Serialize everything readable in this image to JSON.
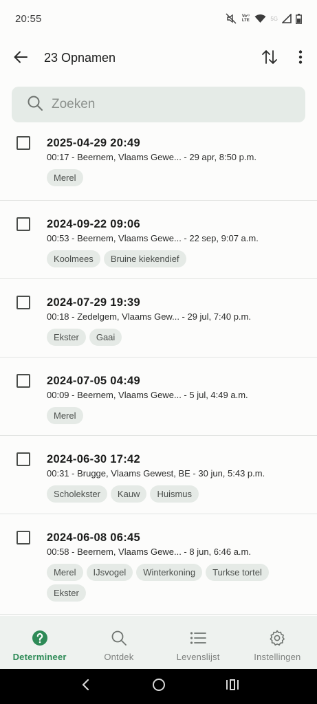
{
  "status_bar": {
    "time": "20:55",
    "volte": "Vo¹⁾ LTE",
    "network": "5G",
    "icons": [
      "mute-icon",
      "volte-icon",
      "wifi-icon",
      "signal-icon",
      "battery-icon"
    ]
  },
  "app_bar": {
    "title": "23 Opnamen",
    "back_icon": "arrow-left-icon",
    "sort_icon": "sort-arrows-icon",
    "more_icon": "more-vertical-icon"
  },
  "search": {
    "placeholder": "Zoeken",
    "value": ""
  },
  "recordings": [
    {
      "title": "2025-04-29 20:49",
      "subtitle": "00:17 - Beernem, Vlaams Gewe... - 29 apr, 8:50 p.m.",
      "tags": [
        "Merel"
      ]
    },
    {
      "title": "2024-09-22 09:06",
      "subtitle": "00:53 - Beernem, Vlaams Gewe... - 22 sep, 9:07 a.m.",
      "tags": [
        "Koolmees",
        "Bruine kiekendief"
      ]
    },
    {
      "title": "2024-07-29 19:39",
      "subtitle": "00:18 - Zedelgem, Vlaams Gew... - 29 jul, 7:40 p.m.",
      "tags": [
        "Ekster",
        "Gaai"
      ]
    },
    {
      "title": "2024-07-05 04:49",
      "subtitle": "00:09 - Beernem, Vlaams Gewe... - 5 jul, 4:49 a.m.",
      "tags": [
        "Merel"
      ]
    },
    {
      "title": "2024-06-30 17:42",
      "subtitle": "00:31 - Brugge, Vlaams Gewest, BE - 30 jun, 5:43 p.m.",
      "tags": [
        "Scholekster",
        "Kauw",
        "Huismus"
      ]
    },
    {
      "title": "2024-06-08 06:45",
      "subtitle": "00:58 - Beernem, Vlaams Gewe... - 8 jun, 6:46 a.m.",
      "tags": [
        "Merel",
        "IJsvogel",
        "Winterkoning",
        "Turkse tortel",
        "Ekster"
      ]
    }
  ],
  "bottom_nav": [
    {
      "label": "Determineer",
      "icon": "help-circle-icon",
      "active": true
    },
    {
      "label": "Ontdek",
      "icon": "search-icon",
      "active": false
    },
    {
      "label": "Levenslijst",
      "icon": "list-icon",
      "active": false
    },
    {
      "label": "Instellingen",
      "icon": "gear-icon",
      "active": false
    }
  ],
  "colors": {
    "accent": "#2e8b57",
    "chip_bg": "#e5eae6",
    "search_bg": "#e5ebe7",
    "nav_bg": "#eef2ef"
  }
}
